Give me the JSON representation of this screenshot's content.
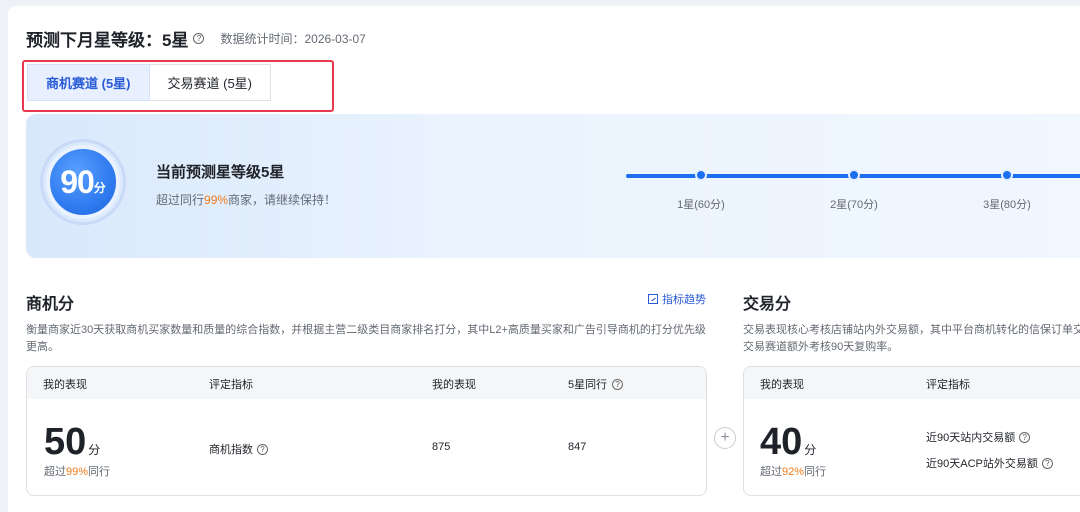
{
  "header": {
    "title": "预测下月星等级：5星",
    "help": "?",
    "stat_time": "数据统计时间：2026-03-07"
  },
  "tabs": [
    {
      "label": "商机赛道 (5星)",
      "active": true
    },
    {
      "label": "交易赛道 (5星)",
      "active": false
    }
  ],
  "banner": {
    "score": "90",
    "score_unit": "分",
    "title": "当前预测星等级5星",
    "sub_prefix": "超过同行",
    "sub_pct": "99%",
    "sub_suffix": "商家，请继续保持！",
    "levels": [
      {
        "label": "1星(60分)"
      },
      {
        "label": "2星(70分)"
      },
      {
        "label": "3星(80分)"
      }
    ]
  },
  "opportunity": {
    "title": "商机分",
    "trend_link": "指标趋势",
    "desc_line1": "衡量商家近30天获取商机买家数量和质量的综合指数，并根据主营二级类目商家排名打分，其中L2+高质量买家和广告引导商机的打分优先级",
    "desc_line2": "更高。",
    "head": {
      "col1": "我的表现",
      "col2": "评定指标",
      "col3": "我的表现",
      "col4": "5星同行"
    },
    "score": "50",
    "score_unit": "分",
    "beat_prefix": "超过",
    "beat_pct": "99%",
    "beat_suffix": "同行",
    "metric": "商机指数",
    "my_value": "875",
    "peer_value": "847"
  },
  "trade": {
    "title": "交易分",
    "desc_line1": "交易表现核心考核店铺站内外交易额，其中平台商机转化的信保订单交",
    "desc_line2": "交易赛道额外考核90天复购率。",
    "head": {
      "col1": "我的表现",
      "col2": "评定指标"
    },
    "score": "40",
    "score_unit": "分",
    "beat_prefix": "超过",
    "beat_pct": "92%",
    "beat_suffix": "同行",
    "metric1": "近90天站内交易额",
    "metric2": "近90天ACP站外交易额"
  },
  "plus": "+",
  "colors": {
    "accent": "#1d6ef0",
    "highlight": "#e8384f",
    "orange": "#f07c1a"
  }
}
